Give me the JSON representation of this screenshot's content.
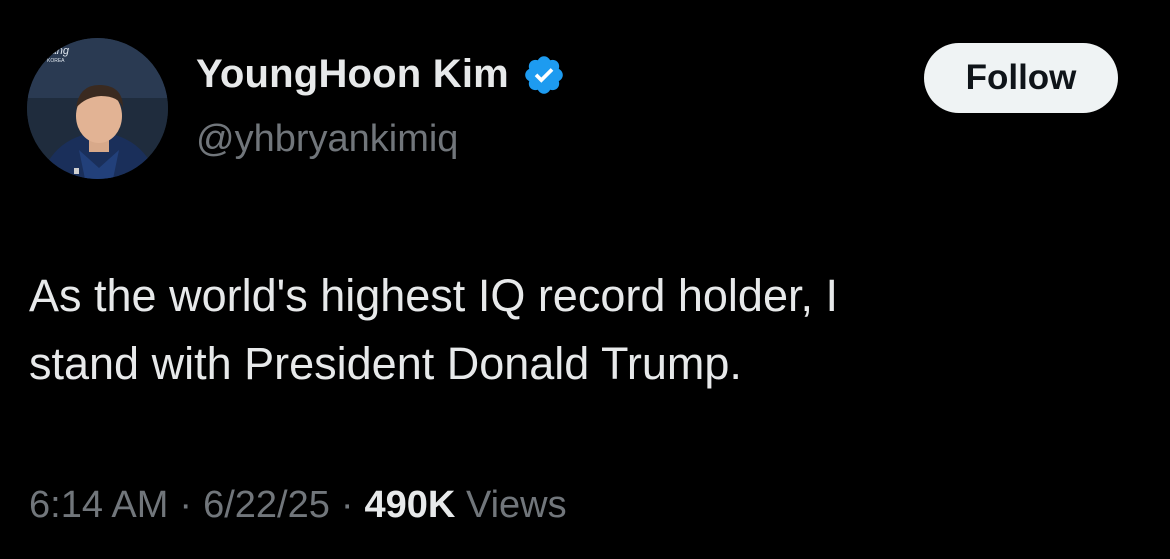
{
  "author": {
    "display_name": "YoungHoon Kim",
    "handle": "@yhbryankimiq",
    "verified": true,
    "avatar_watermark": "arang KOREA",
    "verified_color": "#1d9bf0"
  },
  "follow_button": {
    "label": "Follow"
  },
  "tweet": {
    "lines": [
      "As the world's highest IQ record holder, I",
      "stand with President Donald Trump."
    ]
  },
  "meta": {
    "time": "6:14 AM",
    "date": "6/22/25",
    "separator": "·",
    "views_count": "490K",
    "views_label": "Views"
  }
}
